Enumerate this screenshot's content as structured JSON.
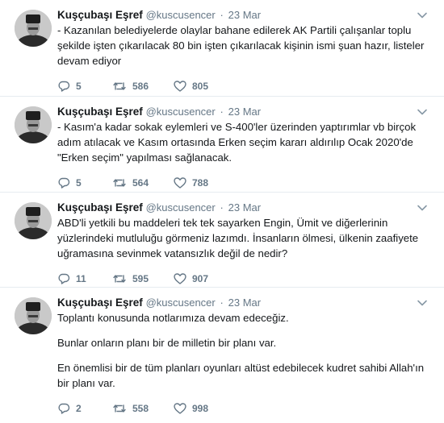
{
  "tweets": [
    {
      "name": "Kuşçubaşı Eşref",
      "handle": "@kuscusencer",
      "date": "23 Mar",
      "paragraphs": [
        "- Kazanılan belediyelerde olaylar bahane edilerek AK Partili çalışanlar toplu şekilde işten çıkarılacak 80 bin işten çıkarılacak kişinin ismi şuan hazır, listeler devam ediyor"
      ],
      "replies": "5",
      "retweets": "586",
      "likes": "805"
    },
    {
      "name": "Kuşçubaşı Eşref",
      "handle": "@kuscusencer",
      "date": "23 Mar",
      "paragraphs": [
        "- Kasım'a kadar sokak eylemleri ve S-400'ler üzerinden yaptırımlar vb birçok adım atılacak ve Kasım ortasında Erken seçim kararı aldırılıp Ocak 2020'de \"Erken seçim\" yapılması sağlanacak."
      ],
      "replies": "5",
      "retweets": "564",
      "likes": "788"
    },
    {
      "name": "Kuşçubaşı Eşref",
      "handle": "@kuscusencer",
      "date": "23 Mar",
      "paragraphs": [
        "ABD'li yetkili bu maddeleri tek tek sayarken Engin, Ümit ve diğerlerinin yüzlerindeki mutluluğu görmeniz lazımdı. İnsanların ölmesi, ülkenin zaafiyete uğramasına sevinmek vatansızlık değil de nedir?"
      ],
      "replies": "11",
      "retweets": "595",
      "likes": "907"
    },
    {
      "name": "Kuşçubaşı Eşref",
      "handle": "@kuscusencer",
      "date": "23 Mar",
      "paragraphs": [
        "Toplantı konusunda notlarımıza devam edeceğiz.",
        "Bunlar onların planı bir de milletin bir planı var.",
        "En önemlisi bir de tüm planları oyunları altüst edebilecek kudret sahibi Allah'ın bir planı var."
      ],
      "replies": "2",
      "retweets": "558",
      "likes": "998"
    }
  ],
  "icons": {
    "reply": "reply-icon",
    "retweet": "retweet-icon",
    "like": "heart-icon",
    "caret": "chevron-down-icon",
    "avatar": "avatar"
  },
  "colors": {
    "name": "#14171a",
    "secondary": "#657786",
    "divider": "#e6ecf0",
    "caret": "#8899a6"
  }
}
